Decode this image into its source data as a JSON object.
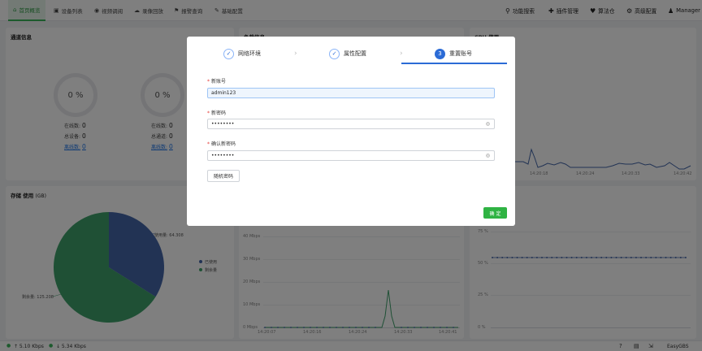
{
  "nav": {
    "left": [
      {
        "icon": "⌂",
        "label": "首页概览"
      },
      {
        "icon": "▣",
        "label": "设备列表"
      },
      {
        "icon": "◉",
        "label": "视频调阅"
      },
      {
        "icon": "☁",
        "label": "录像回放"
      },
      {
        "icon": "⚑",
        "label": "报警查询"
      },
      {
        "icon": "✎",
        "label": "基础配置"
      }
    ],
    "right": [
      {
        "icon": "⚲",
        "label": "功能搜索"
      },
      {
        "icon": "✚",
        "label": "插件管理"
      },
      {
        "icon": "♥",
        "label": "算法仓"
      },
      {
        "icon": "⚙",
        "label": "高级配置"
      },
      {
        "icon": "♟",
        "label": "Manager"
      }
    ]
  },
  "channel": {
    "title": "通道信息",
    "rings": [
      "0 %",
      "0 %"
    ],
    "left_stats": [
      {
        "label": "在线数:",
        "value": "0"
      },
      {
        "label": "总设备:",
        "value": "0"
      },
      {
        "label": "离线数:",
        "value": "0"
      }
    ],
    "right_stats": [
      {
        "label": "在线数:",
        "value": "0"
      },
      {
        "label": "总通道:",
        "value": "0"
      },
      {
        "label": "离线数:",
        "value": "0"
      }
    ]
  },
  "load": {
    "title": "负载信息"
  },
  "cpu": {
    "title": "CPU 使用",
    "x_ticks": [
      "14:20:18",
      "14:20:24",
      "14:20:33",
      "14:20:42"
    ]
  },
  "storage": {
    "title": "存储 使用",
    "unit": "(GB)",
    "legend": [
      "已使用",
      "剩余量"
    ],
    "label_used": "使用量: 64.308",
    "label_free": "剩余量: 125.208",
    "colors": {
      "used": "#4466a8",
      "free": "#3ea06a"
    }
  },
  "chart_data": [
    {
      "type": "pie",
      "title": "存储 使用",
      "categories": [
        "已使用",
        "剩余量"
      ],
      "values": [
        64.308,
        125.208
      ]
    },
    {
      "type": "line",
      "x": [
        "14:20:07",
        "14:20:16",
        "14:20:24",
        "14:20:33",
        "14:20:41"
      ],
      "y_ticks": [
        "0 Mbps",
        "10 Mbps",
        "20 Mbps",
        "30 Mbps",
        "40 Mbps"
      ],
      "ylim": [
        0,
        40
      ],
      "peak": {
        "x_fraction": 0.62,
        "value": 17
      }
    },
    {
      "type": "line",
      "y_ticks": [
        "0 %",
        "25 %",
        "50 %",
        "75 %"
      ],
      "ylim": [
        0,
        75
      ],
      "x": [
        "14:20:07",
        "14:20:16",
        "14:20:24",
        "14:20:33",
        "14:20:41"
      ],
      "value_constant": 50
    }
  ],
  "net": {
    "y_ticks": [
      "40 Mbps",
      "30 Mbps",
      "20 Mbps",
      "10 Mbps",
      "0 Mbps"
    ],
    "x_ticks": [
      "14:20:07",
      "14:20:16",
      "14:20:24",
      "14:20:33",
      "14:20:41"
    ]
  },
  "mem": {
    "y_ticks": [
      "75 %",
      "50 %",
      "25 %",
      "0 %"
    ],
    "x_ticks": [
      "14:20:07",
      "14:20:16",
      "14:20:24",
      "14:20:33",
      "14:20:41"
    ]
  },
  "status": {
    "up": "↑ 5.10 Kbps",
    "down": "↓ 5.34 Kbps",
    "brand": "EasyGBS"
  },
  "modal": {
    "steps": [
      {
        "marker": "✓",
        "label": "网络环境",
        "state": "done"
      },
      {
        "marker": "✓",
        "label": "属性配置",
        "state": "done"
      },
      {
        "marker": "3",
        "label": "重置账号",
        "state": "current"
      }
    ],
    "fields": [
      {
        "label": "新账号",
        "value": "admin123"
      },
      {
        "label": "新密码",
        "value": "••••••••"
      },
      {
        "label": "确认新密码",
        "value": "••••••••"
      }
    ],
    "req_mark": "*",
    "random_btn": "随机密码",
    "ok_btn": "确 定",
    "colors": {
      "accent": "#2b6bd6",
      "ok": "#2fb343"
    }
  }
}
